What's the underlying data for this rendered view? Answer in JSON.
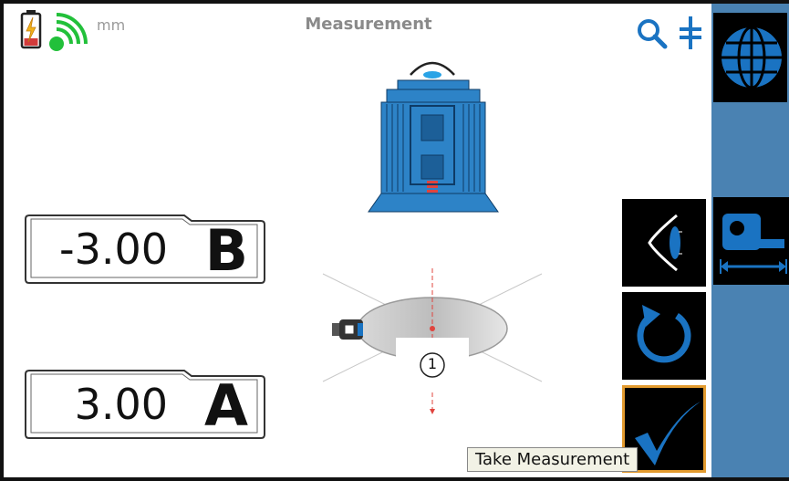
{
  "header": {
    "title": "Measurement",
    "unit": "mm",
    "icons": {
      "battery": "battery-charging-icon",
      "signal": "wireless-signal-icon",
      "search": "search-icon",
      "align": "align-icon"
    }
  },
  "readouts": [
    {
      "value": "-3.00",
      "letter": "B"
    },
    {
      "value": "3.00",
      "letter": "A"
    }
  ],
  "diagram": {
    "position_label": "1"
  },
  "tools": [
    {
      "name": "eye-view-tool",
      "icon": "eye-profile-icon",
      "selected": false
    },
    {
      "name": "rotate-tool",
      "icon": "rotate-icon",
      "selected": false
    },
    {
      "name": "take-measurement-tool",
      "icon": "checkmark-icon",
      "selected": true
    }
  ],
  "sidebar": {
    "buttons": [
      {
        "name": "globe-button",
        "icon": "globe-icon"
      },
      {
        "name": "tape-measure-button",
        "icon": "tape-measure-icon"
      }
    ]
  },
  "tooltip": "Take Measurement",
  "colors": {
    "accent_blue": "#1a73c2",
    "sidebar_blue": "#4a82b2",
    "selected_orange": "#e39b2f",
    "signal_green": "#22c03a",
    "battery_red": "#d23b3b"
  }
}
